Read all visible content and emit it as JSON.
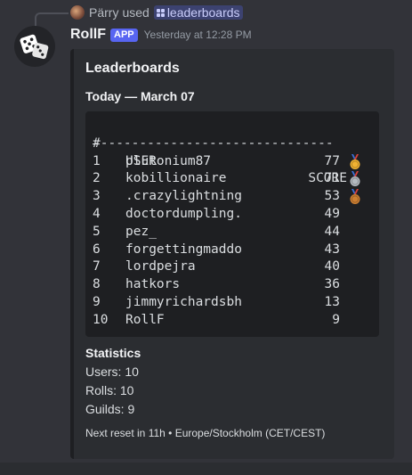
{
  "reply": {
    "author": "Pärry",
    "action": "used",
    "command": "leaderboards"
  },
  "message": {
    "username": "RollF",
    "badge": "APP",
    "timestamp": "Yesterday at 12:28 PM"
  },
  "embed": {
    "title": "Leaderboards",
    "subtitle": "Today — March 07",
    "table": {
      "headers": {
        "rank": "#",
        "user": "USER",
        "score": "SCORE"
      },
      "separator": "-------------------------------",
      "rows": [
        {
          "rank": "1",
          "user": "plutonium87",
          "score": "77",
          "medal": "gold"
        },
        {
          "rank": "2",
          "user": "kobillionaire",
          "score": "71",
          "medal": "silver"
        },
        {
          "rank": "3",
          "user": ".crazylightning",
          "score": "53",
          "medal": "bronze"
        },
        {
          "rank": "4",
          "user": "doctordumpling.",
          "score": "49",
          "medal": ""
        },
        {
          "rank": "5",
          "user": "pez_",
          "score": "44",
          "medal": ""
        },
        {
          "rank": "6",
          "user": "forgettingmaddo",
          "score": "43",
          "medal": ""
        },
        {
          "rank": "7",
          "user": "lordpejra",
          "score": "40",
          "medal": ""
        },
        {
          "rank": "8",
          "user": "hatkors",
          "score": "36",
          "medal": ""
        },
        {
          "rank": "9",
          "user": "jimmyrichardsbh",
          "score": "13",
          "medal": ""
        },
        {
          "rank": "10",
          "user": "RollF",
          "score": "9",
          "medal": ""
        }
      ]
    },
    "statistics": {
      "title": "Statistics",
      "users": "Users: 10",
      "rolls": "Rolls: 10",
      "guilds": "Guilds: 9"
    },
    "footer": "Next reset in 11h • Europe/Stockholm (CET/CEST)"
  },
  "colors": {
    "background": "#323339",
    "embed": "#2b2d31",
    "codeblock": "#1e1f22",
    "app_badge": "#5865f2",
    "gold": "#f0b232",
    "silver": "#b5bac1",
    "bronze": "#cd7f32"
  },
  "icons": {
    "command": "slash-command-grid-icon",
    "avatar": "dice-icon",
    "medals": [
      "gold-medal-icon",
      "silver-medal-icon",
      "bronze-medal-icon"
    ]
  }
}
